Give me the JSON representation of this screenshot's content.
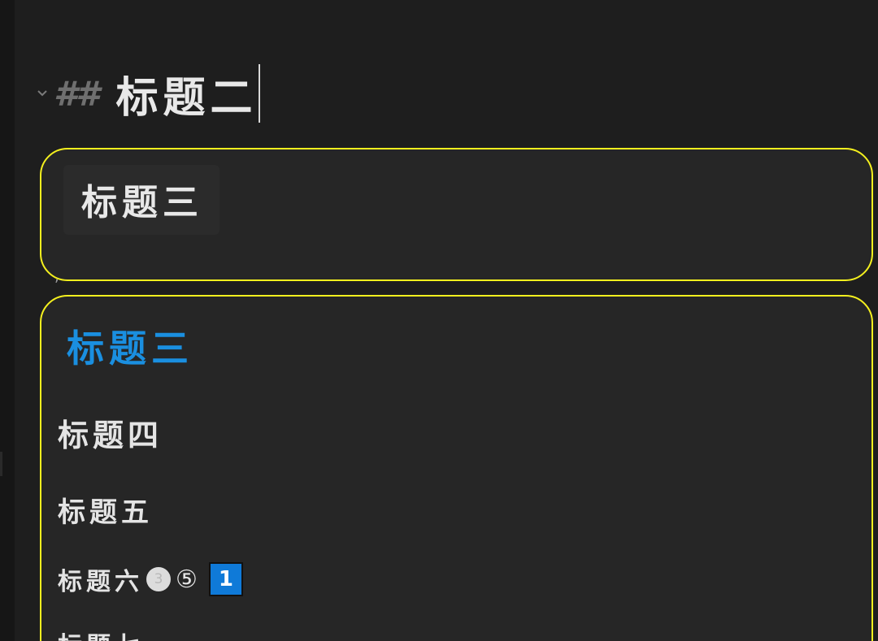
{
  "editor": {
    "h2": {
      "marker": "##",
      "text": "标题二"
    },
    "callout_1": {
      "h3_chip": "标题三",
      "stray_mark": ","
    },
    "callout_2": {
      "h3": "标题三",
      "h4": "标题四",
      "h5": "标题五",
      "h6": {
        "text": "标题六",
        "circled_filled": "3",
        "circled_outline": "⑤",
        "number_box": "1"
      },
      "h7_partial": "标题七"
    }
  },
  "colors": {
    "background": "#1e1e1e",
    "callout_border": "#f4f01e",
    "heading_blue": "#1a8fe0",
    "number_box": "#0f7ad8",
    "marker_gray": "#6f6f6f"
  },
  "icons": {
    "fold": "chevron-down-icon"
  }
}
